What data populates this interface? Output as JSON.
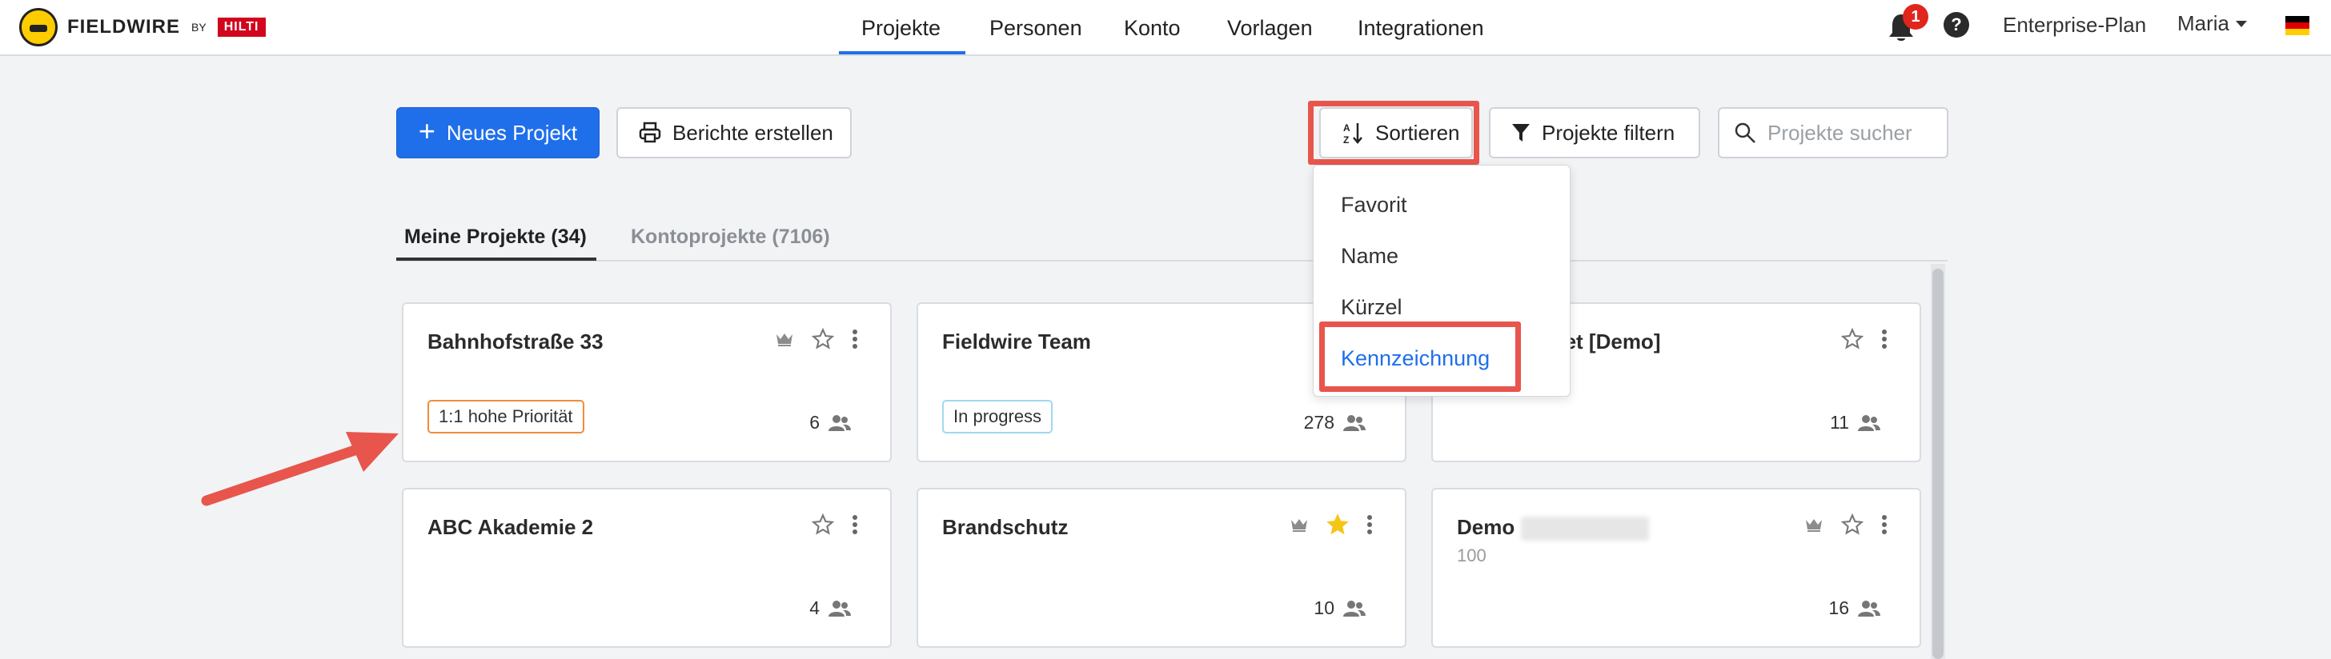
{
  "header": {
    "logo_text": "FIELDWIRE",
    "logo_by": "BY",
    "logo_partner": "HILTI",
    "nav": [
      "Projekte",
      "Personen",
      "Konto",
      "Vorlagen",
      "Integrationen"
    ],
    "active_nav": "Projekte",
    "notification_count": "1",
    "help_icon": "?",
    "plan": "Enterprise-Plan",
    "user": "Maria",
    "language_flag": "de"
  },
  "toolbar": {
    "new_project": "Neues Projekt",
    "reports": "Berichte erstellen",
    "sort": "Sortieren",
    "filter": "Projekte filtern",
    "search_placeholder": "Projekte sucher"
  },
  "tabs": [
    {
      "label": "Meine Projekte (34)",
      "active": true
    },
    {
      "label": "Kontoprojekte (7106)",
      "active": false
    }
  ],
  "sort_menu": {
    "items": [
      "Favorit",
      "Name",
      "Kürzel",
      "Kennzeichnung"
    ],
    "highlighted": "Kennzeichnung"
  },
  "projects": [
    {
      "title": "Bahnhofstraße 33",
      "tag": "1:1 hohe Priorität",
      "tag_color": "#f08c3a",
      "members": "6",
      "crown": true,
      "starred": false
    },
    {
      "title": "Fieldwire Team",
      "tag": "In progress",
      "tag_color": "#9fd8f2",
      "members": "278",
      "crown": false,
      "starred": false
    },
    {
      "title": "reet [Demo]",
      "tag": "",
      "members": "11",
      "crown": false,
      "starred": false
    },
    {
      "title": "ABC Akademie 2",
      "tag": "",
      "members": "4",
      "crown": false,
      "starred": false
    },
    {
      "title": "Brandschutz",
      "tag": "",
      "members": "10",
      "crown": true,
      "starred": true
    },
    {
      "title": "Demo",
      "subtitle": "100",
      "tag": "",
      "members": "16",
      "crown": true,
      "starred": false
    }
  ],
  "colors": {
    "primary": "#1f6feb",
    "annotation": "#e8554c",
    "star_active": "#f5c518"
  }
}
